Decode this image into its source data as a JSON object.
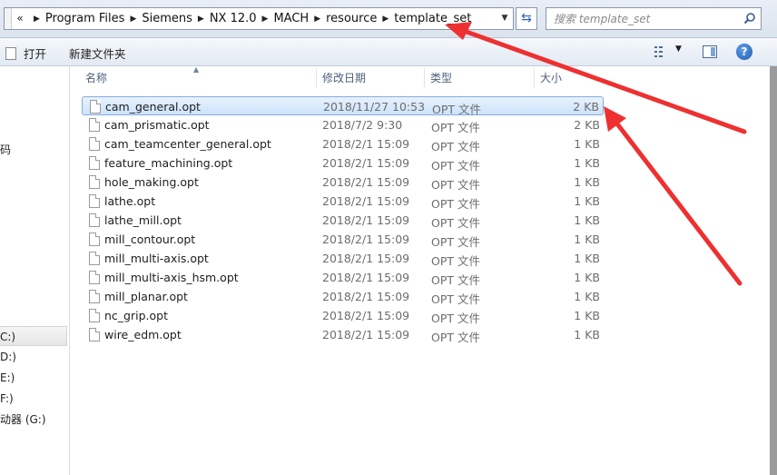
{
  "address": {
    "overflow": "«",
    "crumbs": [
      "Program Files",
      "Siemens",
      "NX 12.0",
      "MACH",
      "resource",
      "template_set"
    ]
  },
  "search": {
    "placeholder": "搜索 template_set"
  },
  "toolbar": {
    "open_label": "打开",
    "new_folder_label": "新建文件夹"
  },
  "nav": {
    "items": [
      {
        "label": "码",
        "selected": false
      },
      {
        "label": "C:)",
        "selected": true
      },
      {
        "label": "D:)",
        "selected": false
      },
      {
        "label": "E:)",
        "selected": false
      },
      {
        "label": "F:)",
        "selected": false
      },
      {
        "label": "动器 (G:)",
        "selected": false
      }
    ]
  },
  "columns": {
    "name": "名称",
    "date": "修改日期",
    "type": "类型",
    "size": "大小"
  },
  "files": [
    {
      "name": "cam_general.opt",
      "date": "2018/11/27 10:53",
      "type": "OPT 文件",
      "size": "2 KB",
      "selected": true
    },
    {
      "name": "cam_prismatic.opt",
      "date": "2018/7/2 9:30",
      "type": "OPT 文件",
      "size": "2 KB",
      "selected": false
    },
    {
      "name": "cam_teamcenter_general.opt",
      "date": "2018/2/1 15:09",
      "type": "OPT 文件",
      "size": "1 KB",
      "selected": false
    },
    {
      "name": "feature_machining.opt",
      "date": "2018/2/1 15:09",
      "type": "OPT 文件",
      "size": "1 KB",
      "selected": false
    },
    {
      "name": "hole_making.opt",
      "date": "2018/2/1 15:09",
      "type": "OPT 文件",
      "size": "1 KB",
      "selected": false
    },
    {
      "name": "lathe.opt",
      "date": "2018/2/1 15:09",
      "type": "OPT 文件",
      "size": "1 KB",
      "selected": false
    },
    {
      "name": "lathe_mill.opt",
      "date": "2018/2/1 15:09",
      "type": "OPT 文件",
      "size": "1 KB",
      "selected": false
    },
    {
      "name": "mill_contour.opt",
      "date": "2018/2/1 15:09",
      "type": "OPT 文件",
      "size": "1 KB",
      "selected": false
    },
    {
      "name": "mill_multi-axis.opt",
      "date": "2018/2/1 15:09",
      "type": "OPT 文件",
      "size": "1 KB",
      "selected": false
    },
    {
      "name": "mill_multi-axis_hsm.opt",
      "date": "2018/2/1 15:09",
      "type": "OPT 文件",
      "size": "1 KB",
      "selected": false
    },
    {
      "name": "mill_planar.opt",
      "date": "2018/2/1 15:09",
      "type": "OPT 文件",
      "size": "1 KB",
      "selected": false
    },
    {
      "name": "nc_grip.opt",
      "date": "2018/2/1 15:09",
      "type": "OPT 文件",
      "size": "1 KB",
      "selected": false
    },
    {
      "name": "wire_edm.opt",
      "date": "2018/2/1 15:09",
      "type": "OPT 文件",
      "size": "1 KB",
      "selected": false
    }
  ],
  "icons": {
    "file": "document-icon",
    "search": "search-icon",
    "refresh": "refresh-icon",
    "help": "help-icon",
    "view": "view-options-icon",
    "pane": "preview-pane-icon"
  },
  "colors": {
    "annotation_arrow": "#ee3030",
    "selection": "#cde3fb"
  }
}
